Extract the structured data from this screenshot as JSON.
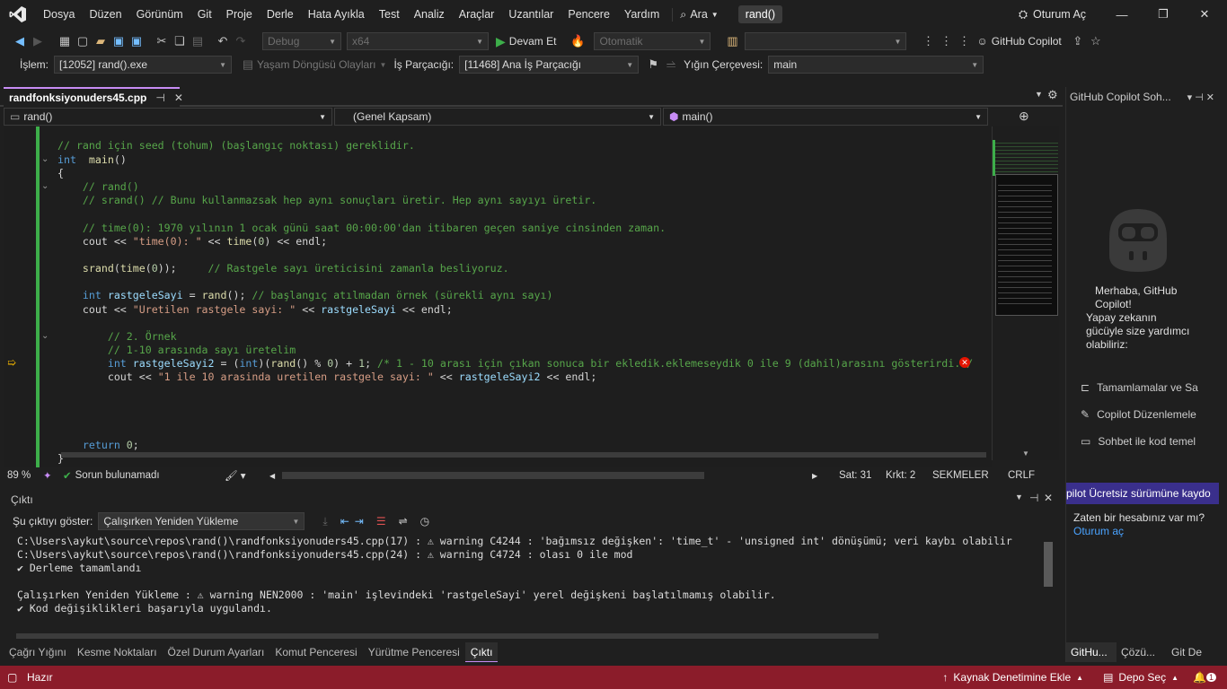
{
  "menubar": {
    "items": [
      "Dosya",
      "Düzen",
      "Görünüm",
      "Git",
      "Proje",
      "Derle",
      "Hata Ayıkla",
      "Test",
      "Analiz",
      "Araçlar",
      "Uzantılar",
      "Pencere",
      "Yardım"
    ],
    "search": "Ara",
    "title": "rand()",
    "signin": "Oturum Aç"
  },
  "toolbar1": {
    "config": "Debug",
    "platform": "x64",
    "continue": "Devam Et",
    "auto": "Otomatik",
    "copilot": "GitHub Copilot"
  },
  "toolbar2": {
    "process_label": "İşlem:",
    "process_value": "[12052] rand().exe",
    "lifecycle": "Yaşam Döngüsü Olayları",
    "thread_label": "İş Parçacığı:",
    "thread_value": "[11468] Ana İş Parçacığı",
    "stack_label": "Yığın Çerçevesi:",
    "stack_value": "main"
  },
  "doc_tab": {
    "name": "randfonksiyonuders45.cpp"
  },
  "navbar": {
    "scope1": "rand()",
    "scope2": "(Genel Kapsam)",
    "scope3": "main()"
  },
  "code": [
    {
      "parts": [
        [
          "cm",
          "// rand için seed (tohum) (başlangıç noktası) gereklidir."
        ]
      ]
    },
    {
      "parts": [
        [
          "kw",
          "int"
        ],
        [
          "",
          "  "
        ],
        [
          "fn",
          "main"
        ],
        [
          "",
          "()"
        ]
      ]
    },
    {
      "parts": [
        [
          "",
          "{"
        ]
      ]
    },
    {
      "parts": [
        [
          "cm",
          "    // rand()"
        ]
      ]
    },
    {
      "parts": [
        [
          "cm",
          "    // srand() // Bunu kullanmazsak hep aynı sonuçları üretir. Hep aynı sayıyı üretir."
        ]
      ]
    },
    {
      "parts": [
        [
          "",
          ""
        ]
      ]
    },
    {
      "parts": [
        [
          "cm",
          "    // time(0): 1970 yılının 1 ocak günü saat 00:00:00'dan itibaren geçen saniye cinsinden zaman."
        ]
      ]
    },
    {
      "parts": [
        [
          "",
          "    cout << "
        ],
        [
          "str",
          "\"time(0): \""
        ],
        [
          "",
          " << "
        ],
        [
          "fn",
          "time"
        ],
        [
          "",
          "("
        ],
        [
          "num",
          "0"
        ],
        [
          "",
          ") << endl;"
        ]
      ]
    },
    {
      "parts": [
        [
          "",
          ""
        ]
      ]
    },
    {
      "parts": [
        [
          "",
          "    "
        ],
        [
          "fn",
          "srand"
        ],
        [
          "",
          "("
        ],
        [
          "fn",
          "time"
        ],
        [
          "",
          "("
        ],
        [
          "num",
          "0"
        ],
        [
          "",
          "));     "
        ],
        [
          "cm",
          "// Rastgele sayı üreticisini zamanla besliyoruz."
        ]
      ]
    },
    {
      "parts": [
        [
          "",
          ""
        ]
      ]
    },
    {
      "parts": [
        [
          "kw",
          "    int"
        ],
        [
          "",
          " "
        ],
        [
          "var",
          "rastgeleSayi"
        ],
        [
          "",
          " = "
        ],
        [
          "fn",
          "rand"
        ],
        [
          "",
          "(); "
        ],
        [
          "cm",
          "// başlangıç atılmadan örnek (sürekli aynı sayı)"
        ]
      ]
    },
    {
      "parts": [
        [
          "",
          "    cout << "
        ],
        [
          "str",
          "\"Uretilen rastgele sayi: \""
        ],
        [
          "",
          " << "
        ],
        [
          "var",
          "rastgeleSayi"
        ],
        [
          "",
          " << endl;"
        ]
      ]
    },
    {
      "parts": [
        [
          "",
          ""
        ]
      ]
    },
    {
      "parts": [
        [
          "cm",
          "        // 2. Örnek"
        ]
      ]
    },
    {
      "parts": [
        [
          "cm",
          "        // 1-10 arasında sayı üretelim"
        ]
      ]
    },
    {
      "parts": [
        [
          "kw",
          "        int"
        ],
        [
          "",
          " "
        ],
        [
          "var",
          "rastgeleSayi2"
        ],
        [
          "",
          " = ("
        ],
        [
          "kw",
          "int"
        ],
        [
          "",
          ")("
        ],
        [
          "fn",
          "rand"
        ],
        [
          "",
          "() % "
        ],
        [
          "num",
          "0"
        ],
        [
          "",
          ") + "
        ],
        [
          "num",
          "1"
        ],
        [
          "",
          "; "
        ],
        [
          "cm",
          "/* 1 - 10 arası için çıkan sonuca bir ekledik.eklemeseydik 0 ile 9 (dahil)arasını gösterirdi.*/"
        ]
      ]
    },
    {
      "parts": [
        [
          "",
          "        cout << "
        ],
        [
          "str",
          "\"1 ile 10 arasinda uretilen rastgele sayi: \""
        ],
        [
          "",
          " << "
        ],
        [
          "var",
          "rastgeleSayi2"
        ],
        [
          "",
          " << endl;"
        ]
      ]
    },
    {
      "parts": [
        [
          "",
          ""
        ]
      ]
    },
    {
      "parts": [
        [
          "",
          ""
        ]
      ]
    },
    {
      "parts": [
        [
          "",
          ""
        ]
      ]
    },
    {
      "parts": [
        [
          "",
          ""
        ]
      ]
    },
    {
      "parts": [
        [
          "",
          "    "
        ],
        [
          "kw",
          "return"
        ],
        [
          "",
          " "
        ],
        [
          "num",
          "0"
        ],
        [
          "",
          ";"
        ]
      ]
    },
    {
      "parts": [
        [
          "",
          "}"
        ]
      ]
    }
  ],
  "editor_status": {
    "zoom": "89 %",
    "issues": "Sorun bulunamadı",
    "line": "Sat: 31",
    "col": "Krkt: 2",
    "tabs": "SEKMELER",
    "eol": "CRLF"
  },
  "output": {
    "title": "Çıktı",
    "show_label": "Şu çıktıyı göster:",
    "source": "Çalışırken Yeniden Yükleme",
    "lines": [
      "C:\\Users\\aykut\\source\\repos\\rand()\\randfonksiyonuders45.cpp(17) : ⚠ warning C4244 : 'bağımsız değişken': 'time_t' - 'unsigned int' dönüşümü; veri kaybı olabilir",
      "C:\\Users\\aykut\\source\\repos\\rand()\\randfonksiyonuders45.cpp(24) : ⚠ warning C4724 : olası 0 ile mod",
      "✔ Derleme tamamlandı",
      "",
      "Çalışırken Yeniden Yükleme : ⚠ warning NEN2000 : 'main' işlevindeki 'rastgeleSayi' yerel değişkeni başlatılmamış olabilir.",
      "✔ Kod değişiklikleri başarıyla uygulandı."
    ]
  },
  "bottom_tabs": [
    "Çağrı Yığını",
    "Kesme Noktaları",
    "Özel Durum Ayarları",
    "Komut Penceresi",
    "Yürütme Penceresi",
    "Çıktı"
  ],
  "copilot": {
    "title": "GitHub Copilot Soh...",
    "greeting": "Merhaba, GitHub Copilot!",
    "subtitle": "Yapay zekanın gücüyle size yardımcı olabiliriz:",
    "items": [
      "Tamamlamalar ve Sa",
      "Copilot Düzenlemele",
      "Sohbet ile kod temel"
    ],
    "banner": "pilot Ücretsiz sürümüne kaydo",
    "account_q": "Zaten bir hesabınız var mı?",
    "signin": "Oturum aç",
    "tabs": [
      "GitHu...",
      "Çözü...",
      "Git De"
    ]
  },
  "statusbar": {
    "ready": "Hazır",
    "source_control": "Kaynak Denetimine Ekle",
    "repo": "Depo Seç",
    "notif": "1"
  }
}
